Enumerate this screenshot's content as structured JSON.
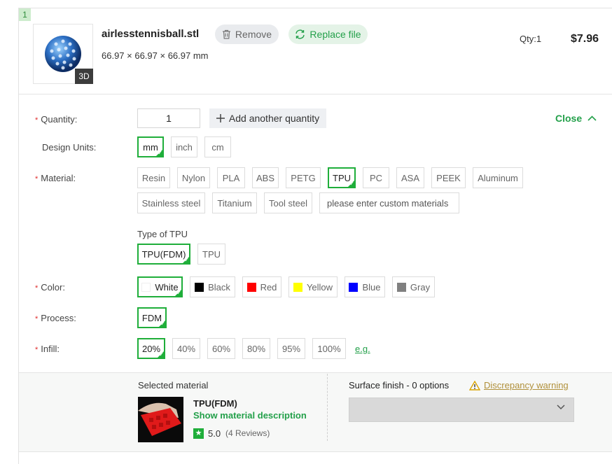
{
  "item": {
    "index": "1",
    "file_name": "airlesstennisball.stl",
    "dimensions": "66.97 × 66.97 × 66.97 mm",
    "badge_3d": "3D",
    "remove_label": "Remove",
    "replace_label": "Replace file",
    "qty_label": "Qty:1",
    "price": "$7.96"
  },
  "form": {
    "quantity_label": "Quantity:",
    "quantity_value": "1",
    "add_quantity_label": "Add another quantity",
    "close_label": "Close",
    "design_units_label": "Design Units:",
    "design_units": [
      "mm",
      "inch",
      "cm"
    ],
    "selected_unit": "mm",
    "material_label": "Material:",
    "materials_row1": [
      "Resin",
      "Nylon",
      "PLA",
      "ABS",
      "PETG",
      "TPU",
      "PC",
      "ASA",
      "PEEK",
      "Aluminum"
    ],
    "materials_row2": [
      "Stainless steel",
      "Titanium",
      "Tool steel"
    ],
    "custom_material_placeholder": "please enter custom materials",
    "selected_material": "TPU",
    "type_title": "Type of TPU",
    "types": [
      "TPU(FDM)",
      "TPU"
    ],
    "selected_type": "TPU(FDM)",
    "color_label": "Color:",
    "colors": [
      {
        "name": "White",
        "hex": "#ffffff"
      },
      {
        "name": "Black",
        "hex": "#000000"
      },
      {
        "name": "Red",
        "hex": "#ff0000"
      },
      {
        "name": "Yellow",
        "hex": "#ffff00"
      },
      {
        "name": "Blue",
        "hex": "#0000ff"
      },
      {
        "name": "Gray",
        "hex": "#808080"
      }
    ],
    "selected_color": "White",
    "process_label": "Process:",
    "process": "FDM",
    "infill_label": "Infill:",
    "infills": [
      "20%",
      "40%",
      "60%",
      "80%",
      "95%",
      "100%"
    ],
    "selected_infill": "20%",
    "eg_link": "e.g."
  },
  "footer": {
    "selected_material_title": "Selected material",
    "material_name": "TPU(FDM)",
    "show_description": "Show material description",
    "rating": "5.0",
    "reviews": "(4 Reviews)",
    "surface_title": "Surface finish - 0 options",
    "warning_label": "Discrepancy warning"
  },
  "colors": {
    "accent_green": "#1fae3a",
    "link_green": "#23a04a",
    "required_red": "#e02f2f",
    "warning_gold": "#b0903a"
  }
}
